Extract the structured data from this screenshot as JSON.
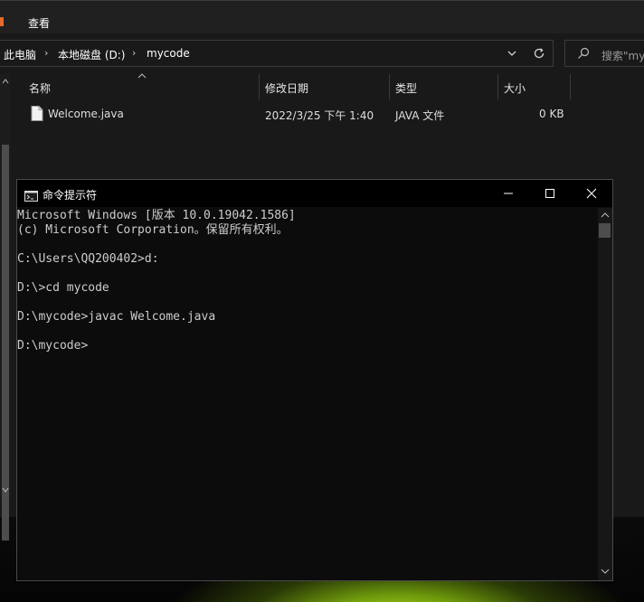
{
  "explorer": {
    "ribbon_tab_view": "查看",
    "breadcrumb": [
      "此电脑",
      "本地磁盘 (D:)",
      "mycode"
    ],
    "search_placeholder": "搜索\"my",
    "columns": {
      "name": "名称",
      "date": "修改日期",
      "type": "类型",
      "size": "大小"
    },
    "files": [
      {
        "name": "Welcome.java",
        "date": "2022/3/25 下午 1:40",
        "type": "JAVA 文件",
        "size": "0 KB"
      }
    ]
  },
  "cmd": {
    "title": "命令提示符",
    "icon": "cmd-icon",
    "lines": [
      "Microsoft Windows [版本 10.0.19042.1586]",
      "(c) Microsoft Corporation。保留所有权利。",
      "",
      "C:\\Users\\QQ200402>d:",
      "",
      "D:\\>cd mycode",
      "",
      "D:\\mycode>javac Welcome.java",
      "",
      "D:\\mycode>"
    ]
  },
  "colors": {
    "explorer_bg": "#191919",
    "cmd_bg": "#0c0c0c",
    "cmd_text": "#cccccc",
    "accent": "#e46a2d"
  }
}
